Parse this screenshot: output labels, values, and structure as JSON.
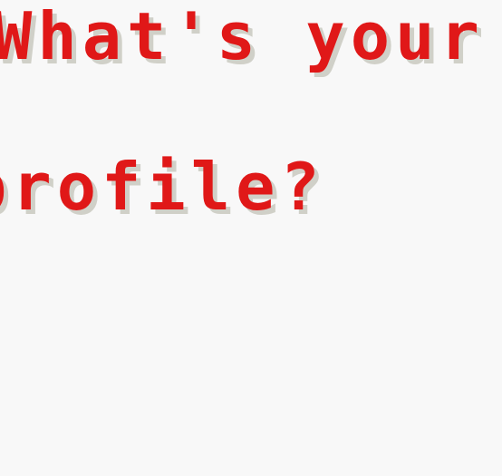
{
  "dialog": {
    "lines": [
      "What's your p",
      "profile?"
    ]
  },
  "colors": {
    "text": "#e01818",
    "text_shadow": "#d0d0c8",
    "background": "#f8f8f8"
  }
}
